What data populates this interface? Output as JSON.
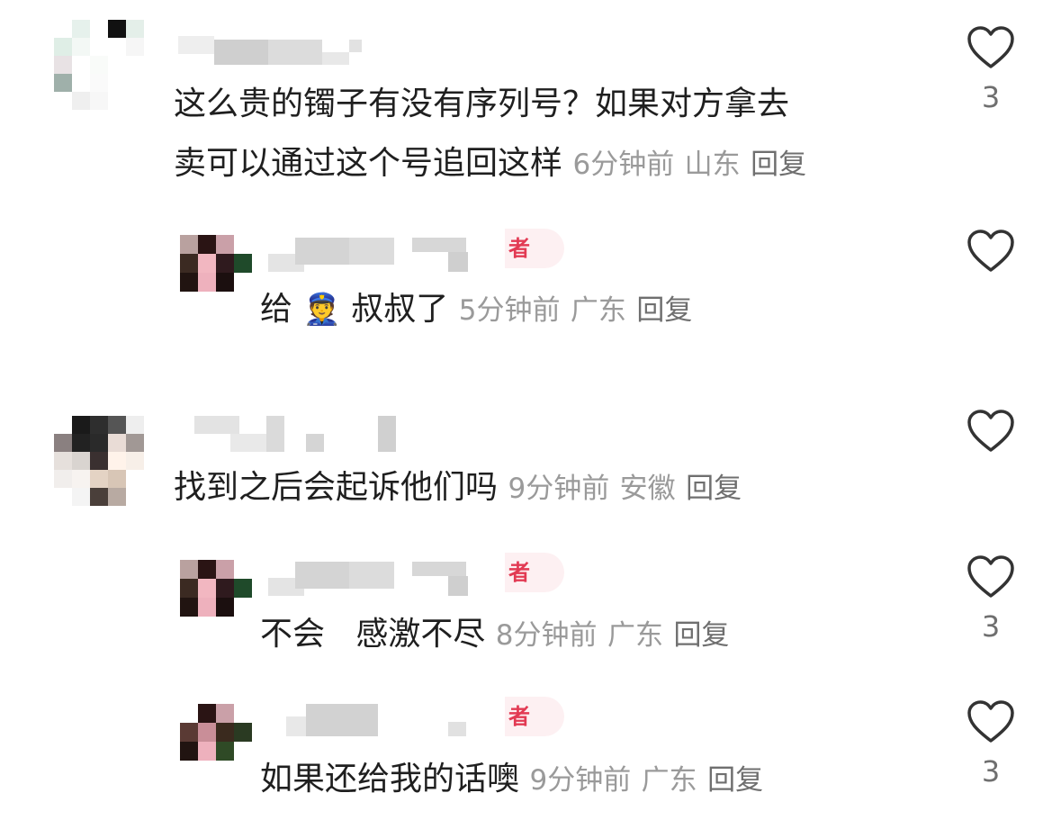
{
  "comments": [
    {
      "text_line1": "这么贵的镯子有没有序列号？如果对方拿去",
      "text_line2": "卖可以通过这个号追回这样",
      "time": "6分钟前",
      "location": "山东",
      "reply_label": "回复",
      "likes": "3"
    },
    {
      "text": "给",
      "emoji": "👮",
      "text_after": "叔叔了",
      "author_badge": "者",
      "time": "5分钟前",
      "location": "广东",
      "reply_label": "回复"
    },
    {
      "text": "找到之后会起诉他们吗",
      "time": "9分钟前",
      "location": "安徽",
      "reply_label": "回复"
    },
    {
      "text": "不会   感激不尽",
      "author_badge": "者",
      "time": "8分钟前",
      "location": "广东",
      "reply_label": "回复",
      "likes": "3"
    },
    {
      "text": "如果还给我的话噢",
      "author_badge": "者",
      "time": "9分钟前",
      "location": "广东",
      "reply_label": "回复",
      "likes": "3"
    }
  ],
  "icons": {
    "like": "heart-outline-icon"
  },
  "colors": {
    "meta": "#9a9a9a",
    "badge_text": "#e23a53",
    "badge_bg": "#fdf0f2"
  }
}
